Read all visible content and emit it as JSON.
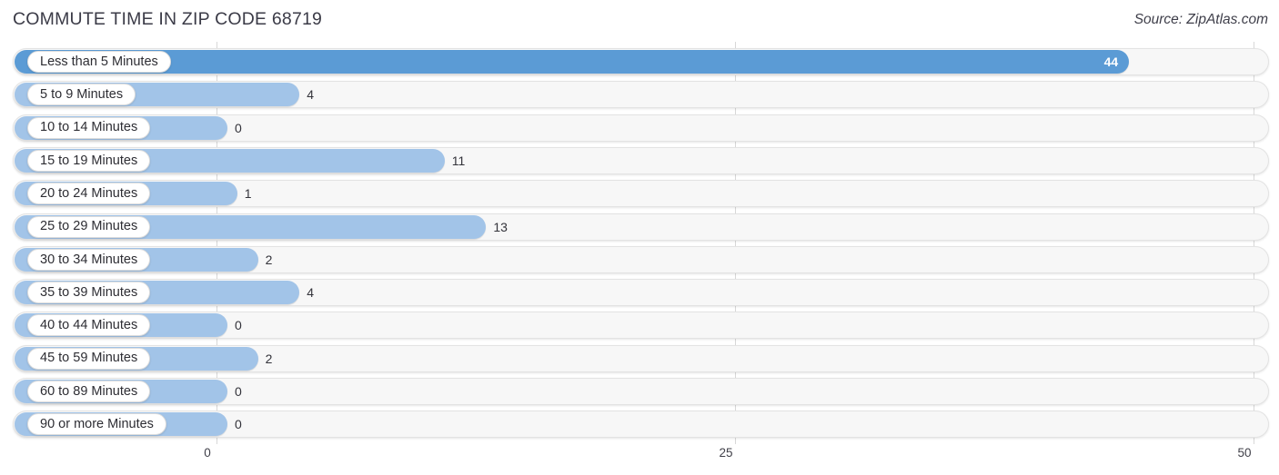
{
  "header": {
    "title": "COMMUTE TIME IN ZIP CODE 68719",
    "source": "Source: ZipAtlas.com"
  },
  "colors": {
    "bar_highlight": "#5b9bd5",
    "bar_default": "#a2c4e8",
    "track_bg": "#f7f7f7",
    "track_border": "#e3e3e3",
    "gridline": "#d8d8d8",
    "text": "#33333a"
  },
  "chart_data": {
    "type": "bar",
    "orientation": "horizontal",
    "title": "COMMUTE TIME IN ZIP CODE 68719",
    "subtitle": "",
    "xlabel": "",
    "ylabel": "",
    "xlim": [
      0,
      50
    ],
    "grid": true,
    "legend": null,
    "xticks": [
      "0",
      "25",
      "50"
    ],
    "xtick_values": [
      0,
      25,
      50
    ],
    "categories": [
      "Less than 5 Minutes",
      "5 to 9 Minutes",
      "10 to 14 Minutes",
      "15 to 19 Minutes",
      "20 to 24 Minutes",
      "25 to 29 Minutes",
      "30 to 34 Minutes",
      "35 to 39 Minutes",
      "40 to 44 Minutes",
      "45 to 59 Minutes",
      "60 to 89 Minutes",
      "90 or more Minutes"
    ],
    "values": [
      44,
      4,
      0,
      11,
      1,
      13,
      2,
      4,
      0,
      2,
      0,
      0
    ],
    "value_labels": [
      "44",
      "4",
      "0",
      "11",
      "1",
      "13",
      "2",
      "4",
      "0",
      "2",
      "0",
      "0"
    ],
    "highlight_index": 0
  },
  "rows": [
    {
      "label": "Less than 5 Minutes",
      "value": 44,
      "value_label": "44",
      "highlight": true
    },
    {
      "label": "5 to 9 Minutes",
      "value": 4,
      "value_label": "4",
      "highlight": false
    },
    {
      "label": "10 to 14 Minutes",
      "value": 0,
      "value_label": "0",
      "highlight": false
    },
    {
      "label": "15 to 19 Minutes",
      "value": 11,
      "value_label": "11",
      "highlight": false
    },
    {
      "label": "20 to 24 Minutes",
      "value": 1,
      "value_label": "1",
      "highlight": false
    },
    {
      "label": "25 to 29 Minutes",
      "value": 13,
      "value_label": "13",
      "highlight": false
    },
    {
      "label": "30 to 34 Minutes",
      "value": 2,
      "value_label": "2",
      "highlight": false
    },
    {
      "label": "35 to 39 Minutes",
      "value": 4,
      "value_label": "4",
      "highlight": false
    },
    {
      "label": "40 to 44 Minutes",
      "value": 0,
      "value_label": "0",
      "highlight": false
    },
    {
      "label": "45 to 59 Minutes",
      "value": 2,
      "value_label": "2",
      "highlight": false
    },
    {
      "label": "60 to 89 Minutes",
      "value": 0,
      "value_label": "0",
      "highlight": false
    },
    {
      "label": "90 or more Minutes",
      "value": 0,
      "value_label": "0",
      "highlight": false
    }
  ]
}
